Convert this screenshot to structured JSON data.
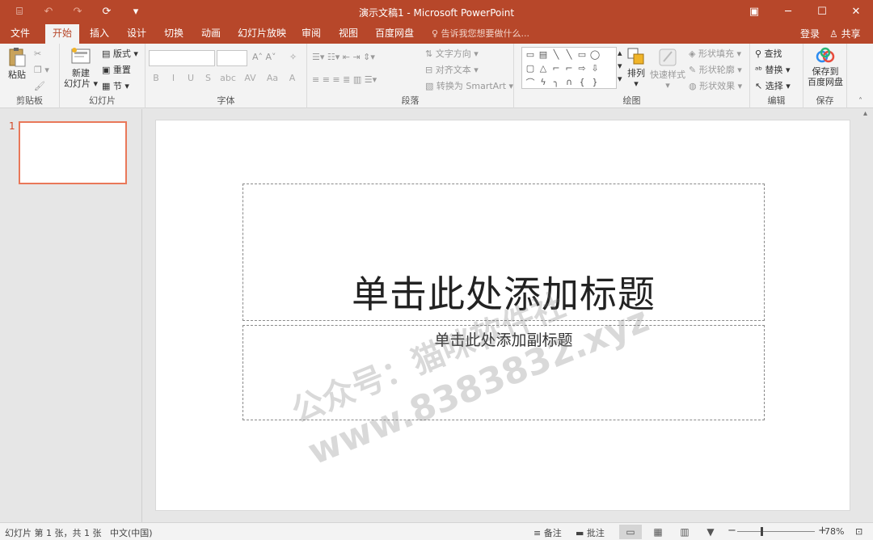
{
  "titlebar": {
    "title": "演示文稿1 - Microsoft PowerPoint",
    "qat": [
      "⌸",
      "↶",
      "↷",
      "⟳",
      "▾"
    ],
    "winctl": [
      "▣",
      "─",
      "☐",
      "✕"
    ]
  },
  "tabs": {
    "items": [
      "文件",
      "开始",
      "插入",
      "设计",
      "切换",
      "动画",
      "幻灯片放映",
      "审阅",
      "视图",
      "百度网盘"
    ],
    "active": "开始",
    "tellme": "♀ 告诉我您想要做什么...",
    "login": "登录",
    "share": "♙ 共享"
  },
  "ribbon": {
    "clipboard": {
      "paste": "粘贴",
      "label": "剪贴板"
    },
    "slides": {
      "new_slide_l1": "新建",
      "new_slide_l2": "幻灯片",
      "layout": "版式",
      "reset": "重置",
      "section": "节",
      "label": "幻灯片"
    },
    "font": {
      "label": "字体",
      "buttons": [
        "B",
        "I",
        "U",
        "S",
        "abc",
        "AV",
        "Aa",
        "A"
      ]
    },
    "paragraph": {
      "text_direction": "文字方向",
      "align_text": "对齐文本",
      "smartart": "转换为 SmartArt",
      "label": "段落"
    },
    "drawing": {
      "arrange": "排列",
      "quick_styles": "快速样式",
      "shape_fill": "形状填充",
      "shape_outline": "形状轮廓",
      "shape_effects": "形状效果",
      "label": "绘图"
    },
    "editing": {
      "find": "查找",
      "replace": "替换",
      "select": "选择",
      "label": "编辑"
    },
    "save": {
      "l1": "保存到",
      "l2": "百度网盘",
      "label": "保存"
    }
  },
  "thumbs": {
    "number": "1"
  },
  "slide": {
    "title_placeholder": "单击此处添加标题",
    "subtitle_placeholder": "单击此处添加副标题",
    "watermark_l1": "公众号：猫咪软件社",
    "watermark_l2": "www.8383832.xyz"
  },
  "status": {
    "slide_info": "幻灯片 第 1 张，共 1 张",
    "language": "中文(中国)",
    "notes": "≡ 备注",
    "comments": "▬ 批注",
    "zoom": "78%",
    "zoom_fraction": 0.78
  },
  "colors": {
    "accent": "#b7472a",
    "thumb_border": "#e97859"
  }
}
